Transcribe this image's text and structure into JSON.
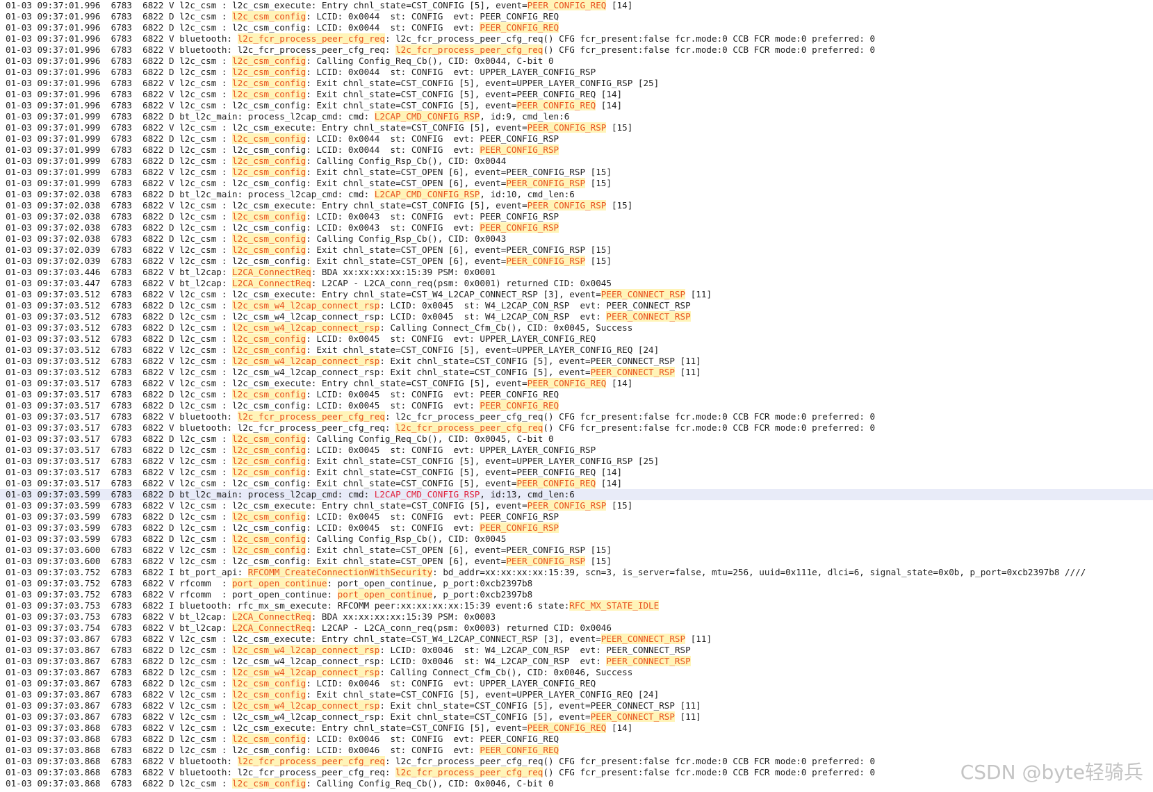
{
  "colors": {
    "background": "#ffffff",
    "text": "#202020",
    "highlight_bg": "#fff4b8",
    "highlight_text": "#e8501e",
    "selected_line_bg": "#e8ebf8"
  },
  "selected_line": 44,
  "watermark": "CSDN @byte轻骑兵",
  "lines": [
    [
      [
        "01-03 09:37:01.996  6783  6822 V l2c_csm : l2c_csm_execute: Entry chnl_state=CST_CONFIG [5], event=",
        0
      ],
      [
        "PEER_CONFIG_REQ",
        1
      ],
      [
        " [14]",
        0
      ]
    ],
    [
      [
        "01-03 09:37:01.996  6783  6822 D l2c_csm : ",
        0
      ],
      [
        "l2c_csm_config",
        1
      ],
      [
        ": LCID: 0x0044  st: CONFIG  evt: PEER_CONFIG_REQ",
        0
      ]
    ],
    [
      [
        "01-03 09:37:01.996  6783  6822 D l2c_csm : l2c_csm_config: LCID: 0x0044  st: CONFIG  evt: ",
        0
      ],
      [
        "PEER_CONFIG_REQ",
        1
      ]
    ],
    [
      [
        "01-03 09:37:01.996  6783  6822 V bluetooth: ",
        0
      ],
      [
        "l2c_fcr_process_peer_cfg_req",
        1
      ],
      [
        ": l2c_fcr_process_peer_cfg_req() CFG fcr_present:false fcr.mode:0 CCB FCR mode:0 preferred: 0",
        0
      ]
    ],
    [
      [
        "01-03 09:37:01.996  6783  6822 V bluetooth: l2c_fcr_process_peer_cfg_req: ",
        0
      ],
      [
        "l2c_fcr_process_peer_cfg_req",
        1
      ],
      [
        "() CFG fcr_present:false fcr.mode:0 CCB FCR mode:0 preferred: 0",
        0
      ]
    ],
    [
      [
        "01-03 09:37:01.996  6783  6822 D l2c_csm : ",
        0
      ],
      [
        "l2c_csm_config",
        1
      ],
      [
        ": Calling Config_Req_Cb(), CID: 0x0044, C-bit 0",
        0
      ]
    ],
    [
      [
        "01-03 09:37:01.996  6783  6822 D l2c_csm : ",
        0
      ],
      [
        "l2c_csm_config",
        1
      ],
      [
        ": LCID: 0x0044  st: CONFIG  evt: UPPER_LAYER_CONFIG_RSP",
        0
      ]
    ],
    [
      [
        "01-03 09:37:01.996  6783  6822 V l2c_csm : ",
        0
      ],
      [
        "l2c_csm_config",
        1
      ],
      [
        ": Exit chnl_state=CST_CONFIG [5], event=UPPER_LAYER_CONFIG_RSP [25]",
        0
      ]
    ],
    [
      [
        "01-03 09:37:01.996  6783  6822 V l2c_csm : ",
        0
      ],
      [
        "l2c_csm_config",
        1
      ],
      [
        ": Exit chnl_state=CST_CONFIG [5], event=PEER_CONFIG_REQ [14]",
        0
      ]
    ],
    [
      [
        "01-03 09:37:01.996  6783  6822 V l2c_csm : l2c_csm_config: Exit chnl_state=CST_CONFIG [5], event=",
        0
      ],
      [
        "PEER_CONFIG_REQ",
        1
      ],
      [
        " [14]",
        0
      ]
    ],
    [
      [
        "01-03 09:37:01.999  6783  6822 D bt_l2c_main: process_l2cap_cmd: cmd: ",
        0
      ],
      [
        "L2CAP_CMD_CONFIG_RSP",
        1
      ],
      [
        ", id:9, cmd_len:6",
        0
      ]
    ],
    [
      [
        "01-03 09:37:01.999  6783  6822 V l2c_csm : l2c_csm_execute: Entry chnl_state=CST_CONFIG [5], event=",
        0
      ],
      [
        "PEER_CONFIG_RSP",
        1
      ],
      [
        " [15]",
        0
      ]
    ],
    [
      [
        "01-03 09:37:01.999  6783  6822 D l2c_csm : ",
        0
      ],
      [
        "l2c_csm_config",
        1
      ],
      [
        ": LCID: 0x0044  st: CONFIG  evt: PEER_CONFIG_RSP",
        0
      ]
    ],
    [
      [
        "01-03 09:37:01.999  6783  6822 D l2c_csm : l2c_csm_config: LCID: 0x0044  st: CONFIG  evt: ",
        0
      ],
      [
        "PEER_CONFIG_RSP",
        1
      ]
    ],
    [
      [
        "01-03 09:37:01.999  6783  6822 D l2c_csm : ",
        0
      ],
      [
        "l2c_csm_config",
        1
      ],
      [
        ": Calling Config_Rsp_Cb(), CID: 0x0044",
        0
      ]
    ],
    [
      [
        "01-03 09:37:01.999  6783  6822 V l2c_csm : ",
        0
      ],
      [
        "l2c_csm_config",
        1
      ],
      [
        ": Exit chnl_state=CST_OPEN [6], event=PEER_CONFIG_RSP [15]",
        0
      ]
    ],
    [
      [
        "01-03 09:37:01.999  6783  6822 V l2c_csm : l2c_csm_config: Exit chnl_state=CST_OPEN [6], event=",
        0
      ],
      [
        "PEER_CONFIG_RSP",
        1
      ],
      [
        " [15]",
        0
      ]
    ],
    [
      [
        "01-03 09:37:02.038  6783  6822 D bt_l2c_main: process_l2cap_cmd: cmd: ",
        0
      ],
      [
        "L2CAP_CMD_CONFIG_RSP",
        1
      ],
      [
        ", id:10, cmd_len:6",
        0
      ]
    ],
    [
      [
        "01-03 09:37:02.038  6783  6822 V l2c_csm : l2c_csm_execute: Entry chnl_state=CST_CONFIG [5], event=",
        0
      ],
      [
        "PEER_CONFIG_RSP",
        1
      ],
      [
        " [15]",
        0
      ]
    ],
    [
      [
        "01-03 09:37:02.038  6783  6822 D l2c_csm : ",
        0
      ],
      [
        "l2c_csm_config",
        1
      ],
      [
        ": LCID: 0x0043  st: CONFIG  evt: PEER_CONFIG_RSP",
        0
      ]
    ],
    [
      [
        "01-03 09:37:02.038  6783  6822 D l2c_csm : l2c_csm_config: LCID: 0x0043  st: CONFIG  evt: ",
        0
      ],
      [
        "PEER_CONFIG_RSP",
        1
      ]
    ],
    [
      [
        "01-03 09:37:02.038  6783  6822 D l2c_csm : ",
        0
      ],
      [
        "l2c_csm_config",
        1
      ],
      [
        ": Calling Config_Rsp_Cb(), CID: 0x0043",
        0
      ]
    ],
    [
      [
        "01-03 09:37:02.039  6783  6822 V l2c_csm : ",
        0
      ],
      [
        "l2c_csm_config",
        1
      ],
      [
        ": Exit chnl_state=CST_OPEN [6], event=PEER_CONFIG_RSP [15]",
        0
      ]
    ],
    [
      [
        "01-03 09:37:02.039  6783  6822 V l2c_csm : l2c_csm_config: Exit chnl_state=CST_OPEN [6], event=",
        0
      ],
      [
        "PEER_CONFIG_RSP",
        1
      ],
      [
        " [15]",
        0
      ]
    ],
    [
      [
        "01-03 09:37:03.446  6783  6822 V bt_l2cap: ",
        0
      ],
      [
        "L2CA_ConnectReq",
        1
      ],
      [
        ": BDA xx:xx:xx:xx:15:39 PSM: 0x0001",
        0
      ]
    ],
    [
      [
        "01-03 09:37:03.447  6783  6822 V bt_l2cap: ",
        0
      ],
      [
        "L2CA_ConnectReq",
        1
      ],
      [
        ": L2CAP - L2CA_conn_req(psm: 0x0001) returned CID: 0x0045",
        0
      ]
    ],
    [
      [
        "01-03 09:37:03.512  6783  6822 V l2c_csm : l2c_csm_execute: Entry chnl_state=CST_W4_L2CAP_CONNECT_RSP [3], event=",
        0
      ],
      [
        "PEER_CONNECT_RSP",
        1
      ],
      [
        " [11]",
        0
      ]
    ],
    [
      [
        "01-03 09:37:03.512  6783  6822 D l2c_csm : ",
        0
      ],
      [
        "l2c_csm_w4_l2cap_connect_rsp",
        1
      ],
      [
        ": LCID: 0x0045  st: W4_L2CAP_CON_RSP  evt: PEER_CONNECT_RSP",
        0
      ]
    ],
    [
      [
        "01-03 09:37:03.512  6783  6822 D l2c_csm : l2c_csm_w4_l2cap_connect_rsp: LCID: 0x0045  st: W4_L2CAP_CON_RSP  evt: ",
        0
      ],
      [
        "PEER_CONNECT_RSP",
        1
      ]
    ],
    [
      [
        "01-03 09:37:03.512  6783  6822 D l2c_csm : ",
        0
      ],
      [
        "l2c_csm_w4_l2cap_connect_rsp",
        1
      ],
      [
        ": Calling Connect_Cfm_Cb(), CID: 0x0045, Success",
        0
      ]
    ],
    [
      [
        "01-03 09:37:03.512  6783  6822 D l2c_csm : ",
        0
      ],
      [
        "l2c_csm_config",
        1
      ],
      [
        ": LCID: 0x0045  st: CONFIG  evt: UPPER_LAYER_CONFIG_REQ",
        0
      ]
    ],
    [
      [
        "01-03 09:37:03.512  6783  6822 V l2c_csm : ",
        0
      ],
      [
        "l2c_csm_config",
        1
      ],
      [
        ": Exit chnl_state=CST_CONFIG [5], event=UPPER_LAYER_CONFIG_REQ [24]",
        0
      ]
    ],
    [
      [
        "01-03 09:37:03.512  6783  6822 V l2c_csm : ",
        0
      ],
      [
        "l2c_csm_w4_l2cap_connect_rsp",
        1
      ],
      [
        ": Exit chnl_state=CST_CONFIG [5], event=PEER_CONNECT_RSP [11]",
        0
      ]
    ],
    [
      [
        "01-03 09:37:03.512  6783  6822 V l2c_csm : l2c_csm_w4_l2cap_connect_rsp: Exit chnl_state=CST_CONFIG [5], event=",
        0
      ],
      [
        "PEER_CONNECT_RSP",
        1
      ],
      [
        " [11]",
        0
      ]
    ],
    [
      [
        "01-03 09:37:03.517  6783  6822 V l2c_csm : l2c_csm_execute: Entry chnl_state=CST_CONFIG [5], event=",
        0
      ],
      [
        "PEER_CONFIG_REQ",
        1
      ],
      [
        " [14]",
        0
      ]
    ],
    [
      [
        "01-03 09:37:03.517  6783  6822 D l2c_csm : ",
        0
      ],
      [
        "l2c_csm_config",
        1
      ],
      [
        ": LCID: 0x0045  st: CONFIG  evt: PEER_CONFIG_REQ",
        0
      ]
    ],
    [
      [
        "01-03 09:37:03.517  6783  6822 D l2c_csm : l2c_csm_config: LCID: 0x0045  st: CONFIG  evt: ",
        0
      ],
      [
        "PEER_CONFIG_REQ",
        1
      ]
    ],
    [
      [
        "01-03 09:37:03.517  6783  6822 V bluetooth: ",
        0
      ],
      [
        "l2c_fcr_process_peer_cfg_req",
        1
      ],
      [
        ": l2c_fcr_process_peer_cfg_req() CFG fcr_present:false fcr.mode:0 CCB FCR mode:0 preferred: 0",
        0
      ]
    ],
    [
      [
        "01-03 09:37:03.517  6783  6822 V bluetooth: l2c_fcr_process_peer_cfg_req: ",
        0
      ],
      [
        "l2c_fcr_process_peer_cfg_req",
        1
      ],
      [
        "() CFG fcr_present:false fcr.mode:0 CCB FCR mode:0 preferred: 0",
        0
      ]
    ],
    [
      [
        "01-03 09:37:03.517  6783  6822 D l2c_csm : ",
        0
      ],
      [
        "l2c_csm_config",
        1
      ],
      [
        ": Calling Config_Req_Cb(), CID: 0x0045, C-bit 0",
        0
      ]
    ],
    [
      [
        "01-03 09:37:03.517  6783  6822 D l2c_csm : ",
        0
      ],
      [
        "l2c_csm_config",
        1
      ],
      [
        ": LCID: 0x0045  st: CONFIG  evt: UPPER_LAYER_CONFIG_RSP",
        0
      ]
    ],
    [
      [
        "01-03 09:37:03.517  6783  6822 V l2c_csm : ",
        0
      ],
      [
        "l2c_csm_config",
        1
      ],
      [
        ": Exit chnl_state=CST_CONFIG [5], event=UPPER_LAYER_CONFIG_RSP [25]",
        0
      ]
    ],
    [
      [
        "01-03 09:37:03.517  6783  6822 V l2c_csm : ",
        0
      ],
      [
        "l2c_csm_config",
        1
      ],
      [
        ": Exit chnl_state=CST_CONFIG [5], event=PEER_CONFIG_REQ [14]",
        0
      ]
    ],
    [
      [
        "01-03 09:37:03.517  6783  6822 V l2c_csm : l2c_csm_config: Exit chnl_state=CST_CONFIG [5], event=",
        0
      ],
      [
        "PEER_CONFIG_REQ",
        1
      ],
      [
        " [14]",
        0
      ]
    ],
    [
      [
        "01-03 09:37:03.599  6783  6822 D bt_l2c_main: process_l2cap_cmd: cmd: ",
        0
      ],
      [
        "L2CAP_CMD_CONFIG_RSP",
        1
      ],
      [
        ", id:13, cmd_len:6",
        0
      ]
    ],
    [
      [
        "01-03 09:37:03.599  6783  6822 V l2c_csm : l2c_csm_execute: Entry chnl_state=CST_CONFIG [5], event=",
        0
      ],
      [
        "PEER_CONFIG_RSP",
        1
      ],
      [
        " [15]",
        0
      ]
    ],
    [
      [
        "01-03 09:37:03.599  6783  6822 D l2c_csm : ",
        0
      ],
      [
        "l2c_csm_config",
        1
      ],
      [
        ": LCID: 0x0045  st: CONFIG  evt: PEER_CONFIG_RSP",
        0
      ]
    ],
    [
      [
        "01-03 09:37:03.599  6783  6822 D l2c_csm : l2c_csm_config: LCID: 0x0045  st: CONFIG  evt: ",
        0
      ],
      [
        "PEER_CONFIG_RSP",
        1
      ]
    ],
    [
      [
        "01-03 09:37:03.599  6783  6822 D l2c_csm : ",
        0
      ],
      [
        "l2c_csm_config",
        1
      ],
      [
        ": Calling Config_Rsp_Cb(), CID: 0x0045",
        0
      ]
    ],
    [
      [
        "01-03 09:37:03.600  6783  6822 V l2c_csm : ",
        0
      ],
      [
        "l2c_csm_config",
        1
      ],
      [
        ": Exit chnl_state=CST_OPEN [6], event=PEER_CONFIG_RSP [15]",
        0
      ]
    ],
    [
      [
        "01-03 09:37:03.600  6783  6822 V l2c_csm : l2c_csm_config: Exit chnl_state=CST_OPEN [6], event=",
        0
      ],
      [
        "PEER_CONFIG_RSP",
        1
      ],
      [
        " [15]",
        0
      ]
    ],
    [
      [
        "01-03 09:37:03.752  6783  6822 I bt_port_api: ",
        0
      ],
      [
        "RFCOMM_CreateConnectionWithSecurity",
        1
      ],
      [
        ": bd_addr=xx:xx:xx:xx:15:39, scn=3, is_server=false, mtu=256, uuid=0x111e, dlci=6, signal_state=0x0b, p_port=0xcb2397b8 ////",
        0
      ]
    ],
    [
      [
        "01-03 09:37:03.752  6783  6822 V rfcomm  : ",
        0
      ],
      [
        "port_open_continue",
        1
      ],
      [
        ": port_open_continue, p_port:0xcb2397b8",
        0
      ]
    ],
    [
      [
        "01-03 09:37:03.752  6783  6822 V rfcomm  : port_open_continue: ",
        0
      ],
      [
        "port_open_continue",
        1
      ],
      [
        ", p_port:0xcb2397b8",
        0
      ]
    ],
    [
      [
        "01-03 09:37:03.753  6783  6822 I bluetooth: rfc_mx_sm_execute: RFCOMM peer:xx:xx:xx:xx:15:39 event:6 state:",
        0
      ],
      [
        "RFC_MX_STATE_IDLE",
        1
      ]
    ],
    [
      [
        "01-03 09:37:03.753  6783  6822 V bt_l2cap: ",
        0
      ],
      [
        "L2CA_ConnectReq",
        1
      ],
      [
        ": BDA xx:xx:xx:xx:15:39 PSM: 0x0003",
        0
      ]
    ],
    [
      [
        "01-03 09:37:03.754  6783  6822 V bt_l2cap: ",
        0
      ],
      [
        "L2CA_ConnectReq",
        1
      ],
      [
        ": L2CAP - L2CA_conn_req(psm: 0x0003) returned CID: 0x0046",
        0
      ]
    ],
    [
      [
        "01-03 09:37:03.867  6783  6822 V l2c_csm : l2c_csm_execute: Entry chnl_state=CST_W4_L2CAP_CONNECT_RSP [3], event=",
        0
      ],
      [
        "PEER_CONNECT_RSP",
        1
      ],
      [
        " [11]",
        0
      ]
    ],
    [
      [
        "01-03 09:37:03.867  6783  6822 D l2c_csm : ",
        0
      ],
      [
        "l2c_csm_w4_l2cap_connect_rsp",
        1
      ],
      [
        ": LCID: 0x0046  st: W4_L2CAP_CON_RSP  evt: PEER_CONNECT_RSP",
        0
      ]
    ],
    [
      [
        "01-03 09:37:03.867  6783  6822 D l2c_csm : l2c_csm_w4_l2cap_connect_rsp: LCID: 0x0046  st: W4_L2CAP_CON_RSP  evt: ",
        0
      ],
      [
        "PEER_CONNECT_RSP",
        1
      ]
    ],
    [
      [
        "01-03 09:37:03.867  6783  6822 D l2c_csm : ",
        0
      ],
      [
        "l2c_csm_w4_l2cap_connect_rsp",
        1
      ],
      [
        ": Calling Connect_Cfm_Cb(), CID: 0x0046, Success",
        0
      ]
    ],
    [
      [
        "01-03 09:37:03.867  6783  6822 D l2c_csm : ",
        0
      ],
      [
        "l2c_csm_config",
        1
      ],
      [
        ": LCID: 0x0046  st: CONFIG  evt: UPPER_LAYER_CONFIG_REQ",
        0
      ]
    ],
    [
      [
        "01-03 09:37:03.867  6783  6822 V l2c_csm : ",
        0
      ],
      [
        "l2c_csm_config",
        1
      ],
      [
        ": Exit chnl_state=CST_CONFIG [5], event=UPPER_LAYER_CONFIG_REQ [24]",
        0
      ]
    ],
    [
      [
        "01-03 09:37:03.867  6783  6822 V l2c_csm : ",
        0
      ],
      [
        "l2c_csm_w4_l2cap_connect_rsp",
        1
      ],
      [
        ": Exit chnl_state=CST_CONFIG [5], event=PEER_CONNECT_RSP [11]",
        0
      ]
    ],
    [
      [
        "01-03 09:37:03.867  6783  6822 V l2c_csm : l2c_csm_w4_l2cap_connect_rsp: Exit chnl_state=CST_CONFIG [5], event=",
        0
      ],
      [
        "PEER_CONNECT_RSP",
        1
      ],
      [
        " [11]",
        0
      ]
    ],
    [
      [
        "01-03 09:37:03.868  6783  6822 V l2c_csm : l2c_csm_execute: Entry chnl_state=CST_CONFIG [5], event=",
        0
      ],
      [
        "PEER_CONFIG_REQ",
        1
      ],
      [
        " [14]",
        0
      ]
    ],
    [
      [
        "01-03 09:37:03.868  6783  6822 D l2c_csm : ",
        0
      ],
      [
        "l2c_csm_config",
        1
      ],
      [
        ": LCID: 0x0046  st: CONFIG  evt: PEER_CONFIG_REQ",
        0
      ]
    ],
    [
      [
        "01-03 09:37:03.868  6783  6822 D l2c_csm : l2c_csm_config: LCID: 0x0046  st: CONFIG  evt: ",
        0
      ],
      [
        "PEER_CONFIG_REQ",
        1
      ]
    ],
    [
      [
        "01-03 09:37:03.868  6783  6822 V bluetooth: ",
        0
      ],
      [
        "l2c_fcr_process_peer_cfg_req",
        1
      ],
      [
        ": l2c_fcr_process_peer_cfg_req() CFG fcr_present:false fcr.mode:0 CCB FCR mode:0 preferred: 0",
        0
      ]
    ],
    [
      [
        "01-03 09:37:03.868  6783  6822 V bluetooth: l2c_fcr_process_peer_cfg_req: ",
        0
      ],
      [
        "l2c_fcr_process_peer_cfg_req",
        1
      ],
      [
        "() CFG fcr_present:false fcr.mode:0 CCB FCR mode:0 preferred: 0",
        0
      ]
    ],
    [
      [
        "01-03 09:37:03.868  6783  6822 D l2c_csm : ",
        0
      ],
      [
        "l2c_csm_config",
        1
      ],
      [
        ": Calling Config_Req_Cb(), CID: 0x0046, C-bit 0",
        0
      ]
    ]
  ]
}
